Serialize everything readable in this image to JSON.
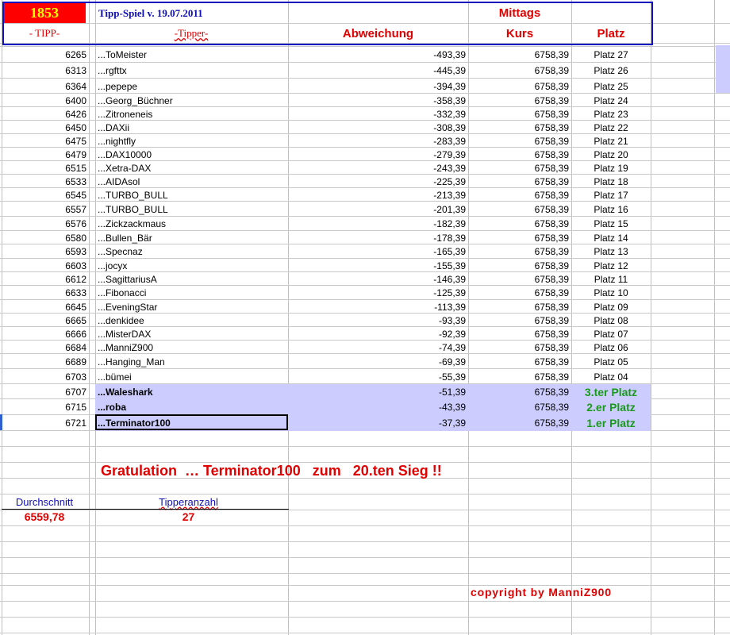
{
  "header": {
    "tipp_count": "1853",
    "title": "Tipp-Spiel v. 19.07.2011",
    "mittags": "Mittags",
    "col_tipp": "- TIPP-",
    "col_tipper": "-Tipper-",
    "col_abweichung": "Abweichung",
    "col_kurs": "Kurs",
    "col_platz": "Platz"
  },
  "rows": [
    {
      "tipp": "6265",
      "tipper": "...ToMeister",
      "abw": "-493,39",
      "kurs": "6758,39",
      "platz": "Platz 27"
    },
    {
      "tipp": "6313",
      "tipper": "...rgfttx",
      "abw": "-445,39",
      "kurs": "6758,39",
      "platz": "Platz 26"
    },
    {
      "tipp": "6364",
      "tipper": "...pepepe",
      "abw": "-394,39",
      "kurs": "6758,39",
      "platz": "Platz 25"
    },
    {
      "tipp": "6400",
      "tipper": "...Georg_Büchner",
      "abw": "-358,39",
      "kurs": "6758,39",
      "platz": "Platz 24"
    },
    {
      "tipp": "6426",
      "tipper": "...Zitroneneis",
      "abw": "-332,39",
      "kurs": "6758,39",
      "platz": "Platz 23"
    },
    {
      "tipp": "6450",
      "tipper": "...DAXii",
      "abw": "-308,39",
      "kurs": "6758,39",
      "platz": "Platz 22"
    },
    {
      "tipp": "6475",
      "tipper": "...nightfly",
      "abw": "-283,39",
      "kurs": "6758,39",
      "platz": "Platz 21"
    },
    {
      "tipp": "6479",
      "tipper": "...DAX10000",
      "abw": "-279,39",
      "kurs": "6758,39",
      "platz": "Platz 20"
    },
    {
      "tipp": "6515",
      "tipper": "...Xetra-DAX",
      "abw": "-243,39",
      "kurs": "6758,39",
      "platz": "Platz 19"
    },
    {
      "tipp": "6533",
      "tipper": "...AIDAsol",
      "abw": "-225,39",
      "kurs": "6758,39",
      "platz": "Platz 18"
    },
    {
      "tipp": "6545",
      "tipper": "...TURBO_BULL",
      "abw": "-213,39",
      "kurs": "6758,39",
      "platz": "Platz 17"
    },
    {
      "tipp": "6557",
      "tipper": "...TURBO_BULL",
      "abw": "-201,39",
      "kurs": "6758,39",
      "platz": "Platz 16"
    },
    {
      "tipp": "6576",
      "tipper": "...Zickzackmaus",
      "abw": "-182,39",
      "kurs": "6758,39",
      "platz": "Platz 15"
    },
    {
      "tipp": "6580",
      "tipper": "...Bullen_Bär",
      "abw": "-178,39",
      "kurs": "6758,39",
      "platz": "Platz 14"
    },
    {
      "tipp": "6593",
      "tipper": "...Specnaz",
      "abw": "-165,39",
      "kurs": "6758,39",
      "platz": "Platz 13"
    },
    {
      "tipp": "6603",
      "tipper": "...jocyx",
      "abw": "-155,39",
      "kurs": "6758,39",
      "platz": "Platz 12"
    },
    {
      "tipp": "6612",
      "tipper": "...SagittariusA",
      "abw": "-146,39",
      "kurs": "6758,39",
      "platz": "Platz 11"
    },
    {
      "tipp": "6633",
      "tipper": "...Fibonacci",
      "abw": "-125,39",
      "kurs": "6758,39",
      "platz": "Platz 10"
    },
    {
      "tipp": "6645",
      "tipper": "...EveningStar",
      "abw": "-113,39",
      "kurs": "6758,39",
      "platz": "Platz 09"
    },
    {
      "tipp": "6665",
      "tipper": "...denkidee",
      "abw": "-93,39",
      "kurs": "6758,39",
      "platz": "Platz 08"
    },
    {
      "tipp": "6666",
      "tipper": "...MisterDAX",
      "abw": "-92,39",
      "kurs": "6758,39",
      "platz": "Platz 07"
    },
    {
      "tipp": "6684",
      "tipper": "...ManniZ900",
      "abw": "-74,39",
      "kurs": "6758,39",
      "platz": "Platz 06"
    },
    {
      "tipp": "6689",
      "tipper": "...Hanging_Man",
      "abw": "-69,39",
      "kurs": "6758,39",
      "platz": "Platz 05"
    },
    {
      "tipp": "6703",
      "tipper": "...bümei",
      "abw": "-55,39",
      "kurs": "6758,39",
      "platz": "Platz 04"
    },
    {
      "tipp": "6707",
      "tipper": "...Waleshark",
      "abw": "-51,39",
      "kurs": "6758,39",
      "platz": "3.ter Platz",
      "top": true
    },
    {
      "tipp": "6715",
      "tipper": "...roba",
      "abw": "-43,39",
      "kurs": "6758,39",
      "platz": "2.er Platz",
      "top": true
    },
    {
      "tipp": "6721",
      "tipper": "...Terminator100",
      "abw": "-37,39",
      "kurs": "6758,39",
      "platz": "1.er Platz",
      "top": true,
      "selected": true
    }
  ],
  "gratulation": "Gratulation  … Terminator100   zum   20.ten Sieg !!",
  "stats": {
    "durchschnitt_label": "Durchschnitt",
    "durchschnitt_value": "6559,78",
    "tipperanzahl_label": "Tipperanzahl",
    "tipperanzahl_value": "27"
  },
  "copyright": "copyright by ManniZ900",
  "colors": {
    "highlight": "#ccccff",
    "red": "#e00000",
    "blue": "#0000c0",
    "green": "#1a9a1a"
  }
}
